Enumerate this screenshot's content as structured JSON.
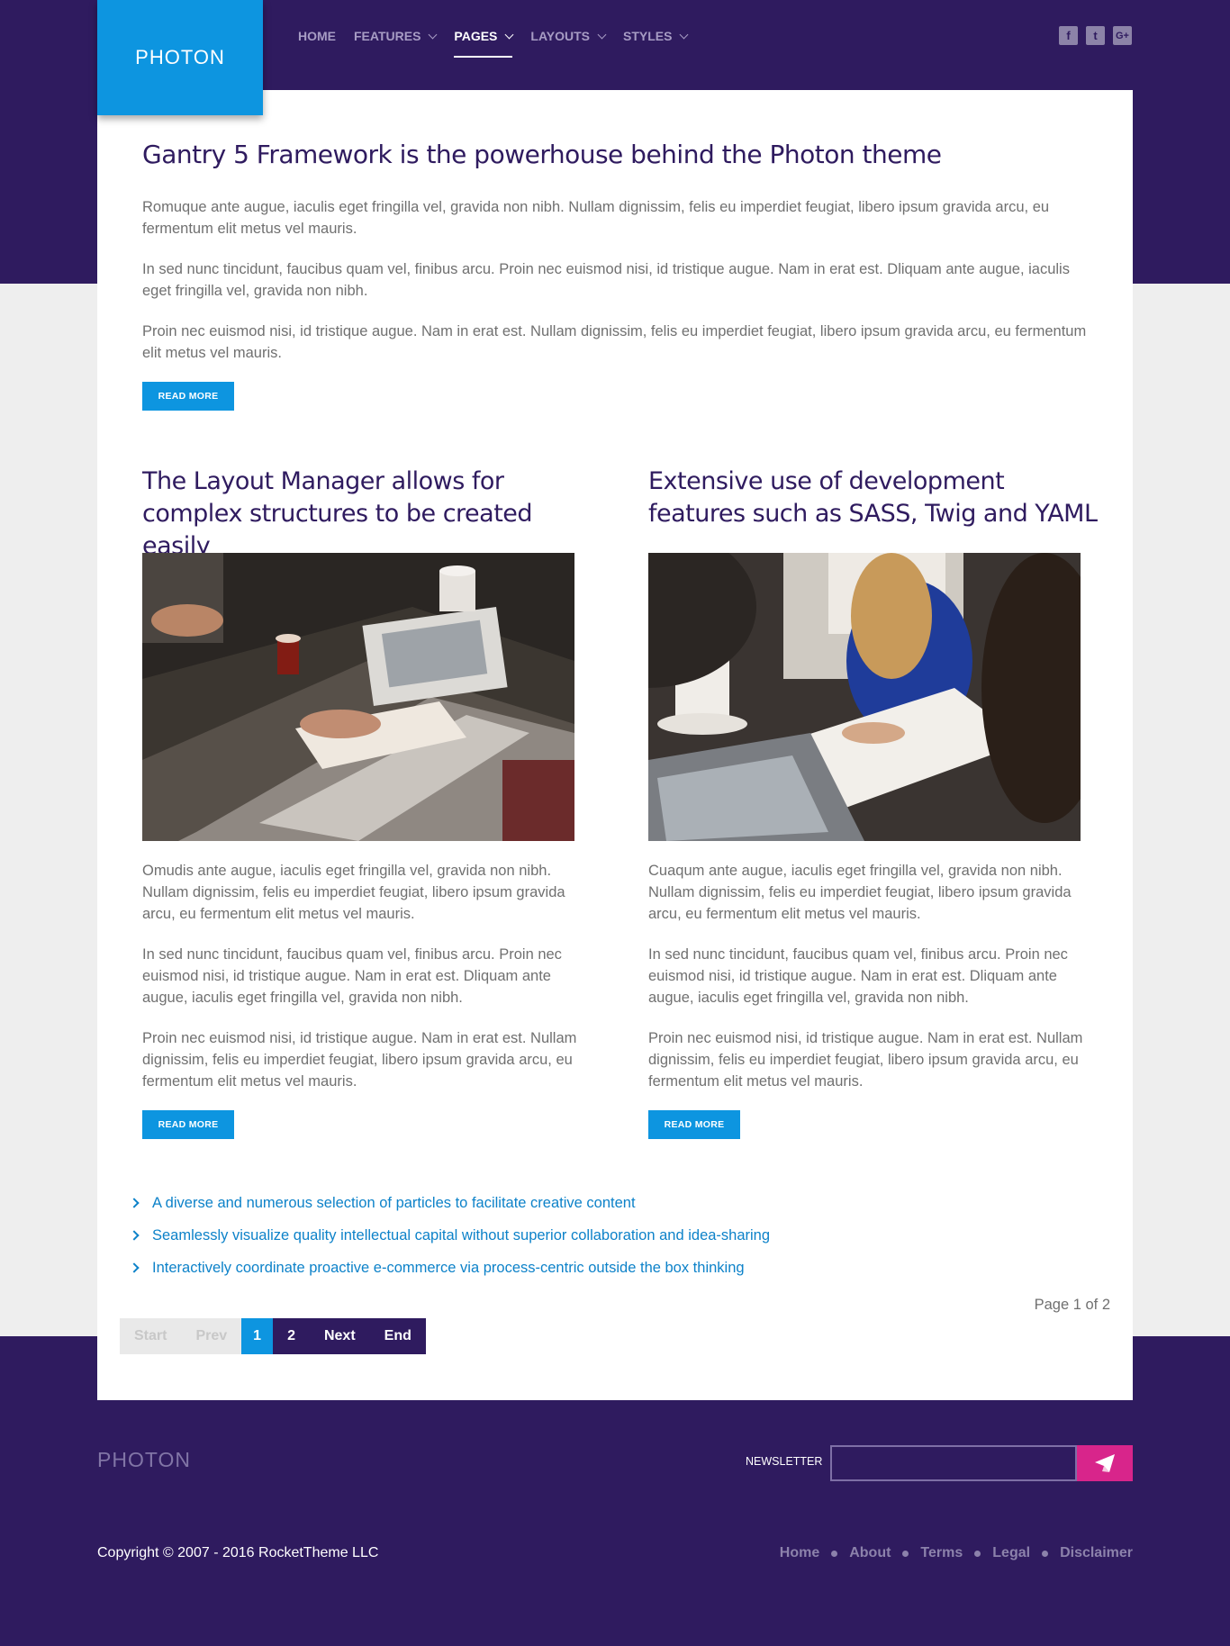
{
  "brand": {
    "logo_text": "PHOTON"
  },
  "nav": {
    "items": [
      {
        "label": "HOME"
      },
      {
        "label": "FEATURES"
      },
      {
        "label": "PAGES"
      },
      {
        "label": "LAYOUTS"
      },
      {
        "label": "STYLES"
      }
    ],
    "active": "PAGES"
  },
  "social": {
    "facebook": "f",
    "twitter": "t",
    "google_plus": "G+"
  },
  "lead": {
    "title": "Gantry 5 Framework is the powerhouse behind the Photon theme",
    "paragraphs": [
      "Romuque ante augue, iaculis eget fringilla vel, gravida non nibh. Nullam dignissim, felis eu imperdiet feugiat, libero ipsum gravida arcu, eu fermentum elit metus vel mauris.",
      "In sed nunc tincidunt, faucibus quam vel, finibus arcu. Proin nec euismod nisi, id tristique augue. Nam in erat est. Dliquam ante augue, iaculis eget fringilla vel, gravida non nibh.",
      "Proin nec euismod nisi, id tristique augue. Nam in erat est. Nullam dignissim, felis eu imperdiet feugiat, libero ipsum gravida arcu, eu fermentum elit metus vel mauris."
    ],
    "button": "READ MORE"
  },
  "columns": [
    {
      "title": "The Layout Manager allows for complex structures to be created easily",
      "paragraphs": [
        "Omudis ante augue, iaculis eget fringilla vel, gravida non nibh. Nullam dignissim, felis eu imperdiet feugiat, libero ipsum gravida arcu, eu fermentum elit metus vel mauris.",
        "In sed nunc tincidunt, faucibus quam vel, finibus arcu. Proin nec euismod nisi, id tristique augue. Nam in erat est. Dliquam ante augue, iaculis eget fringilla vel, gravida non nibh.",
        "Proin nec euismod nisi, id tristique augue. Nam in erat est. Nullam dignissim, felis eu imperdiet feugiat, libero ipsum gravida arcu, eu fermentum elit metus vel mauris."
      ],
      "button": "READ MORE"
    },
    {
      "title": "Extensive use of development features such as SASS, Twig and YAML",
      "paragraphs": [
        "Cuaqum ante augue, iaculis eget fringilla vel, gravida non nibh. Nullam dignissim, felis eu imperdiet feugiat, libero ipsum gravida arcu, eu fermentum elit metus vel mauris.",
        "In sed nunc tincidunt, faucibus quam vel, finibus arcu. Proin nec euismod nisi, id tristique augue. Nam in erat est. Dliquam ante augue, iaculis eget fringilla vel, gravida non nibh.",
        "Proin nec euismod nisi, id tristique augue. Nam in erat est. Nullam dignissim, felis eu imperdiet feugiat, libero ipsum gravida arcu, eu fermentum elit metus vel mauris."
      ],
      "button": "READ MORE"
    }
  ],
  "links": [
    "A diverse and numerous selection of particles to facilitate creative content",
    "Seamlessly visualize quality intellectual capital without superior collaboration and idea-sharing",
    "Interactively coordinate proactive e-commerce via process-centric outside the box thinking"
  ],
  "pagination": {
    "summary": "Page 1 of 2",
    "start": "Start",
    "prev": "Prev",
    "pages": [
      "1",
      "2"
    ],
    "current": "1",
    "next": "Next",
    "end": "End"
  },
  "footer": {
    "logo_text": "PHOTON",
    "newsletter_label": "NEWSLETTER",
    "newsletter_value": "",
    "copyright": "Copyright © 2007 - 2016 RocketTheme LLC",
    "links": [
      "Home",
      "About",
      "Terms",
      "Legal",
      "Disclaimer"
    ]
  },
  "colors": {
    "header_bg": "#2f1b5f",
    "accent_blue": "#0d95e0",
    "link_blue": "#0d82c9",
    "newsletter_button": "#d8258b",
    "page_bg": "#eeeeee"
  }
}
